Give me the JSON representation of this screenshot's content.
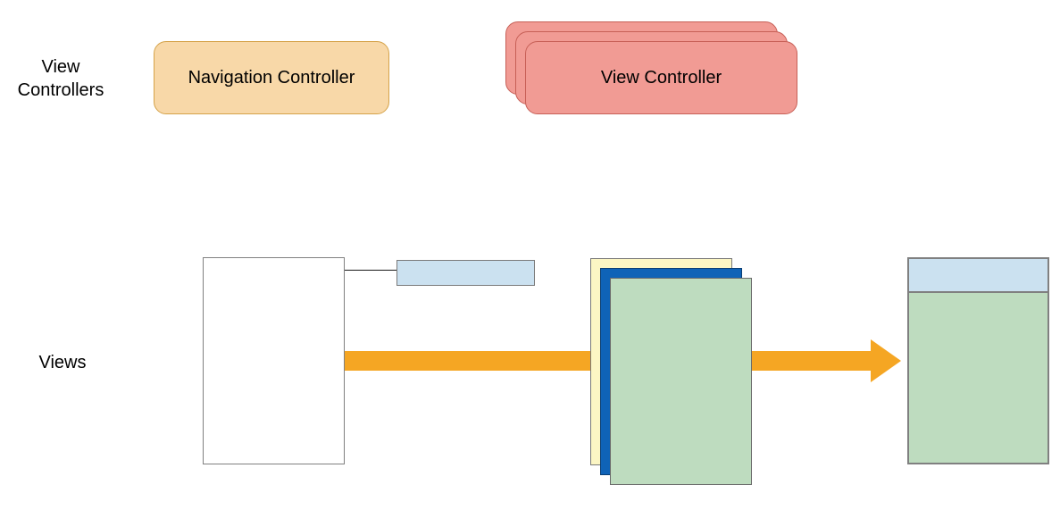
{
  "labels": {
    "viewControllers": "View\nControllers",
    "views": "Views"
  },
  "boxes": {
    "navController": "Navigation Controller",
    "viewController": "View Controller"
  },
  "colors": {
    "navigation": "#F8D8A8",
    "viewController": "#F19B94",
    "lightBlue": "#CBE1F0",
    "yellow": "#FCF6C4",
    "deepBlue": "#0F63B7",
    "green": "#BEDCBF",
    "arrow": "#F5A623",
    "white": "#FFFFFF",
    "border": "#808080"
  },
  "diagram": {
    "description": "Two rows: View Controllers (Navigation Controller + stacked View Controller). Views row shows a white container with small blue nav-bar rectangle connected by a line, an orange arrow through a stack of colored views (yellow, blue, green), continuing to a composed view (nav bar on top of green content)."
  }
}
